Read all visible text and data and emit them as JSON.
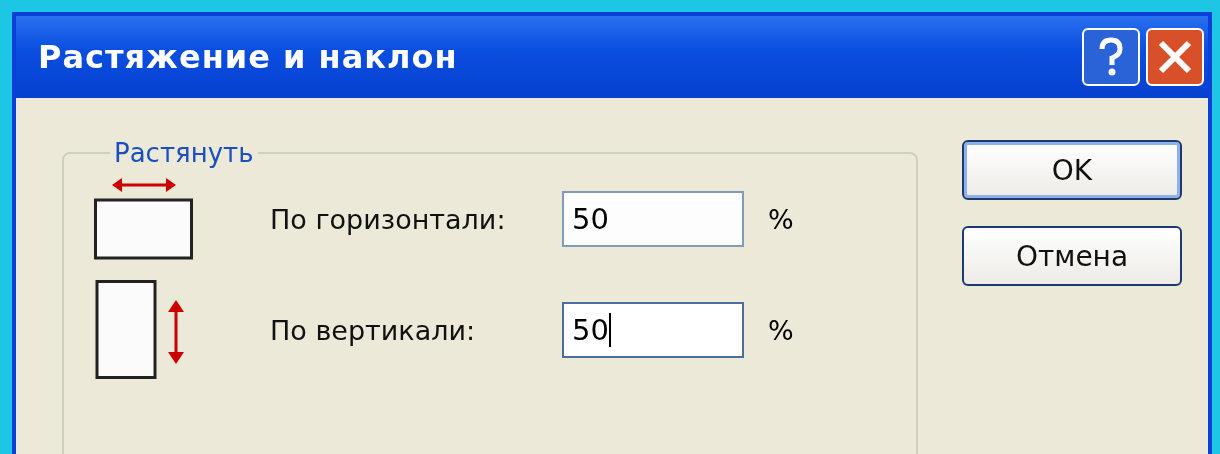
{
  "window": {
    "title": "Растяжение и наклон"
  },
  "stretch_group": {
    "legend": "Растянуть",
    "fields": [
      {
        "kind": "horizontal",
        "label": "По горизонтали:",
        "value": "50",
        "unit": "%",
        "focused": false
      },
      {
        "kind": "vertical",
        "label": "По вертикали:",
        "value": "50",
        "unit": "%",
        "focused": true
      }
    ]
  },
  "buttons": [
    {
      "label": "OK",
      "default": true
    },
    {
      "label": "Отмена",
      "default": false
    }
  ]
}
